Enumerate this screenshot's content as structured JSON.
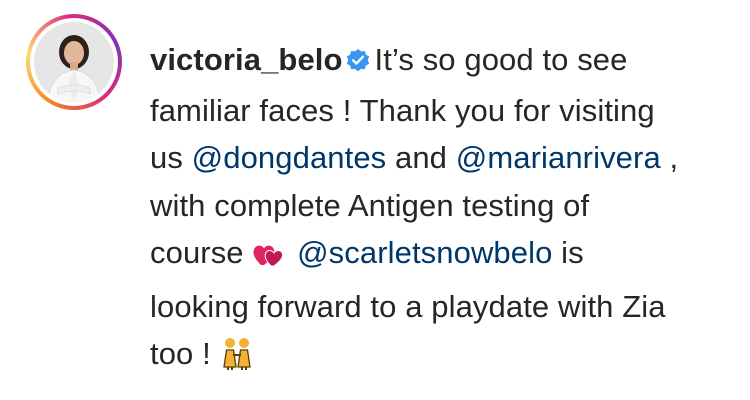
{
  "comment": {
    "username": "victoria_belo",
    "text_1": "It’s so good to see",
    "text_2": "familiar faces ! Thank you for visiting",
    "text_3a": "us",
    "mention_1": "@dongdantes",
    "text_3b": "and",
    "mention_2": "@marianrivera",
    "text_3c": ",",
    "text_4": "with complete Antigen testing of",
    "text_5a": "course",
    "mention_3": "@scarletsnowbelo",
    "text_5b": "is",
    "text_6": "looking forward to a playdate with Zia",
    "text_7": "too !"
  },
  "icons": {
    "verified": "verified-badge-icon",
    "hearts": "two-hearts-emoji",
    "people": "people-holding-hands-emoji"
  },
  "colors": {
    "text": "#262626",
    "mention": "#00376b",
    "verified": "#3897f0",
    "heart": "#e0245e",
    "avatar_ring": "#dd2a7b"
  }
}
